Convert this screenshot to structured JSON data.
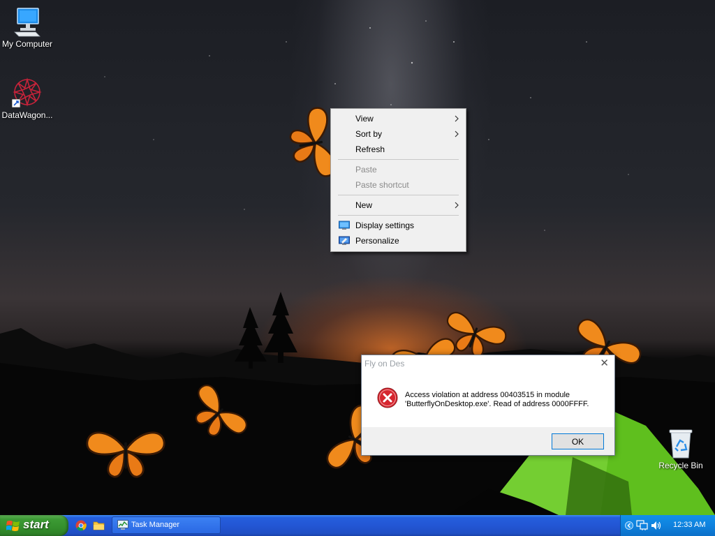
{
  "desktop": {
    "icons": [
      {
        "label": "My Computer"
      },
      {
        "label": "DataWagon..."
      },
      {
        "label": "Recycle Bin"
      }
    ]
  },
  "context_menu": {
    "items": [
      {
        "label": "View",
        "has_submenu": true,
        "enabled": true
      },
      {
        "label": "Sort by",
        "has_submenu": true,
        "enabled": true
      },
      {
        "label": "Refresh",
        "enabled": true
      },
      {
        "label": "Paste",
        "enabled": false
      },
      {
        "label": "Paste shortcut",
        "enabled": false
      },
      {
        "label": "New",
        "has_submenu": true,
        "enabled": true
      },
      {
        "label": "Display settings",
        "icon": "display-icon",
        "enabled": true
      },
      {
        "label": "Personalize",
        "icon": "personalize-icon",
        "enabled": true
      }
    ]
  },
  "error_dialog": {
    "title": "Fly on Des",
    "close_glyph": "✕",
    "icon": "error-icon",
    "message": "Access violation at address 00403515 in module 'ButterflyOnDesktop.exe'. Read of address 0000FFFF.",
    "ok_label": "OK"
  },
  "taskbar": {
    "start_label": "start",
    "quick_launch": [
      "chrome-icon",
      "folder-icon"
    ],
    "task_label": "Task Manager",
    "tray_icons": [
      "chevron-left-icon",
      "network-icon",
      "volume-icon"
    ],
    "clock": "12:33 AM"
  },
  "colors": {
    "taskbar_blue": "#245edc",
    "start_green": "#3c9a34",
    "tray_blue": "#0f82de",
    "butterfly_orange": "#f08a1c",
    "ok_border": "#0078d7"
  }
}
